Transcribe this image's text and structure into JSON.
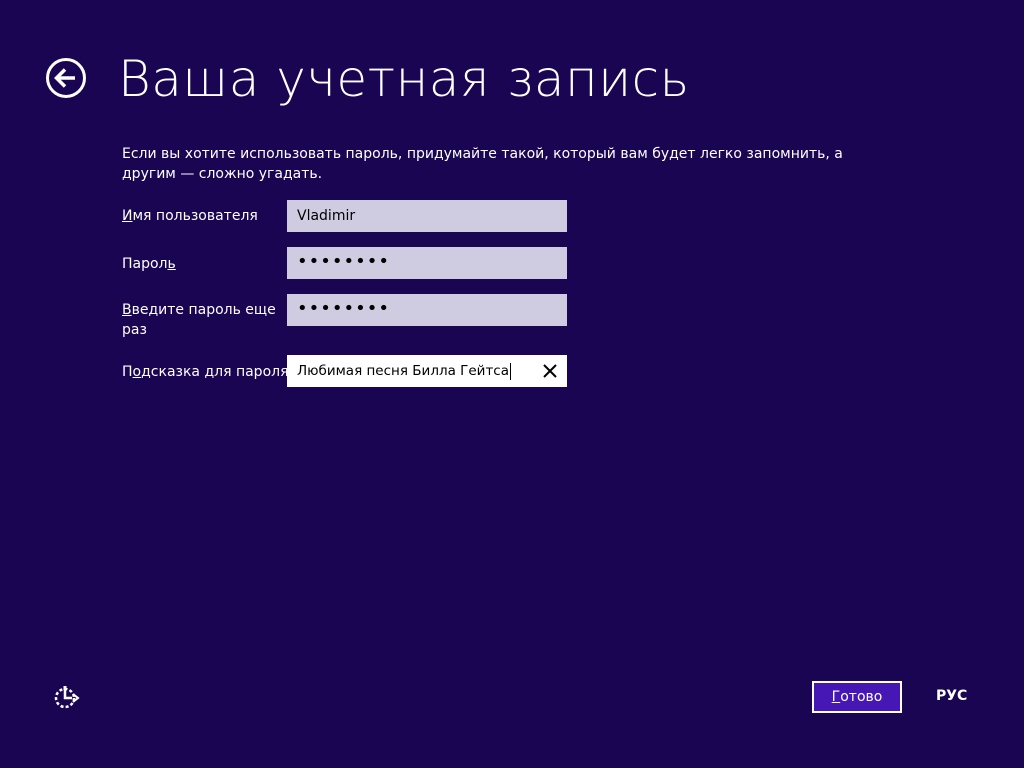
{
  "header": {
    "title": "Ваша учетная запись",
    "back_icon": "back-arrow-icon"
  },
  "description": "Если вы хотите использовать пароль, придумайте такой, который вам будет легко запомнить, а другим — сложно угадать.",
  "form": {
    "username": {
      "label_prefix": "",
      "label_accel": "И",
      "label_rest": "мя пользователя",
      "value": "Vladimir"
    },
    "password": {
      "label_prefix": "Парол",
      "label_accel": "ь",
      "label_rest": "",
      "value": "••••••••"
    },
    "password_confirm": {
      "label_prefix": "",
      "label_accel": "В",
      "label_rest": "ведите пароль еще раз",
      "value": "••••••••"
    },
    "hint": {
      "label_prefix": "П",
      "label_accel": "о",
      "label_rest": "дсказка для пароля",
      "value": "Любимая песня Билла Гейтса",
      "clear_icon": "close-icon"
    }
  },
  "footer": {
    "accessibility_icon": "ease-of-access-icon",
    "done_prefix": "",
    "done_accel": "Г",
    "done_rest": "отово",
    "language": "РУС"
  },
  "colors": {
    "background": "#1a0553",
    "field_inactive": "#cfcbe0",
    "field_active": "#ffffff",
    "button": "#4617b4"
  }
}
